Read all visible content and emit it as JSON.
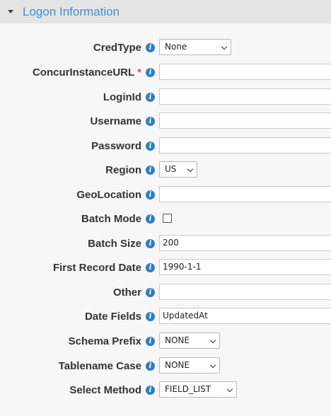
{
  "section": {
    "title": "Logon Information"
  },
  "info_glyph": "i",
  "required_mark": "*",
  "fields": {
    "credtype": {
      "label": "CredType",
      "value": "None"
    },
    "instance_url": {
      "label": "ConcurInstanceURL",
      "value": ""
    },
    "loginid": {
      "label": "LoginId",
      "value": ""
    },
    "username": {
      "label": "Username",
      "value": ""
    },
    "password": {
      "label": "Password",
      "value": ""
    },
    "region": {
      "label": "Region",
      "value": "US"
    },
    "geolocation": {
      "label": "GeoLocation",
      "value": ""
    },
    "batch_mode": {
      "label": "Batch Mode",
      "checked": false
    },
    "batch_size": {
      "label": "Batch Size",
      "value": "200"
    },
    "first_record_date": {
      "label": "First Record Date",
      "value": "1990-1-1"
    },
    "other": {
      "label": "Other",
      "value": ""
    },
    "date_fields": {
      "label": "Date Fields",
      "value": "UpdatedAt"
    },
    "schema_prefix": {
      "label": "Schema Prefix",
      "value": "NONE"
    },
    "tablename_case": {
      "label": "Tablename Case",
      "value": "NONE"
    },
    "select_method": {
      "label": "Select Method",
      "value": "FIELD_LIST"
    }
  },
  "colors": {
    "accent": "#3d8fd1",
    "info_icon": "#2f7ec4",
    "required": "#d9534f"
  },
  "icons": {
    "section_toggle": "caret-down-icon",
    "help": "info-icon"
  }
}
